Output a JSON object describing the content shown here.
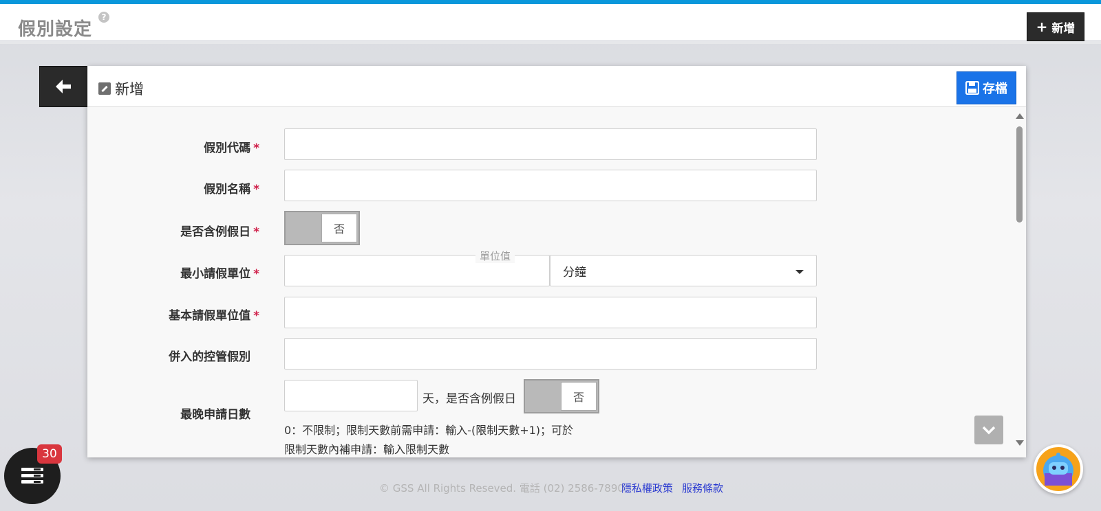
{
  "header": {
    "title": "假別設定",
    "help_glyph": "?",
    "add_button_label": "新增"
  },
  "panel": {
    "title": "新增",
    "save_label": "存檔"
  },
  "form": {
    "leave_code": {
      "label": "假別代碼",
      "required_mark": "*",
      "value": ""
    },
    "leave_name": {
      "label": "假別名稱",
      "required_mark": "*",
      "value": ""
    },
    "include_holidays": {
      "label": "是否含例假日",
      "required_mark": "*",
      "toggle_value": "否"
    },
    "min_unit": {
      "label": "最小請假單位",
      "required_mark": "*",
      "value_caption": "單位值",
      "value": "",
      "unit_selected": "分鐘"
    },
    "base_unit_value": {
      "label": "基本請假單位值",
      "required_mark": "*",
      "value": ""
    },
    "merged_leave": {
      "label": "併入的控管假別",
      "value": ""
    },
    "latest_apply_days": {
      "label": "最晚申請日數",
      "value": "",
      "suffix": "天，是否含例假日",
      "toggle_value": "否",
      "hint_line1": "0：不限制；限制天數前需申請：輸入-(限制天數+1)；可於",
      "hint_line2": "限制天數內補申請：輸入限制天數"
    }
  },
  "footer": {
    "copyright": "© GSS All Rights Reseved. 電話 (02) 2586-7890",
    "privacy_link": "隱私權政策",
    "terms_link": "服務條款"
  },
  "notifications": {
    "count": "30"
  },
  "colors": {
    "top_stripe": "#0a97db",
    "save_button": "#1a73e8",
    "required_mark": "#d0214b",
    "badge": "#d9363e",
    "bot_bg": "#f6a21a",
    "link": "#2a3ad0"
  },
  "icons": [
    "help-icon",
    "plus-icon",
    "back-arrow-icon",
    "edit-icon",
    "save-disk-icon",
    "chevron-down-icon",
    "caret-down-icon",
    "list-icon",
    "robot-icon"
  ]
}
